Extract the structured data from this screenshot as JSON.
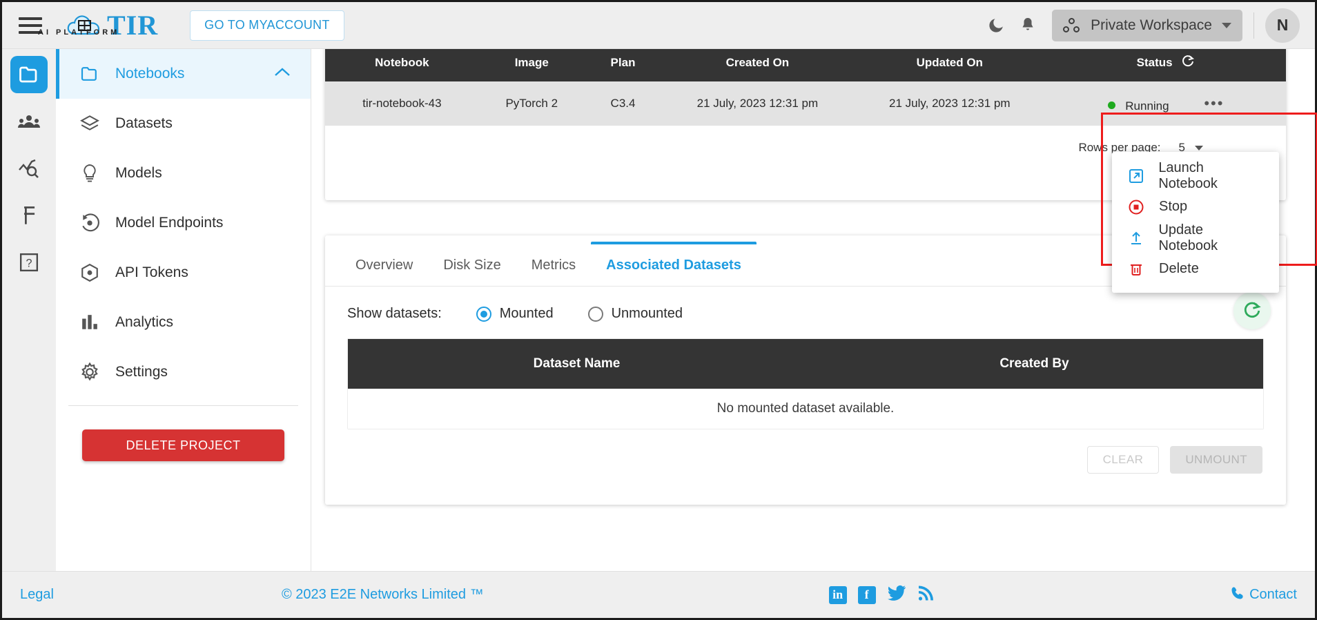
{
  "topbar": {
    "menu_icon": "hamburger-icon",
    "logo_text": "TIR",
    "logo_sub": "AI PLATFORM",
    "myaccount_label": "GO TO MYACCOUNT",
    "dark_mode_icon": "moon-icon",
    "notifications_icon": "bell-icon",
    "workspace_label": "Private Workspace",
    "avatar_initial": "N"
  },
  "rail": {
    "items": [
      {
        "icon": "folder-icon",
        "name": "projects",
        "active": true
      },
      {
        "icon": "users-icon",
        "name": "team",
        "active": false
      },
      {
        "icon": "analytics-search-icon",
        "name": "monitoring",
        "active": false
      },
      {
        "icon": "rupee-icon",
        "name": "billing",
        "active": false
      },
      {
        "icon": "help-icon",
        "name": "help",
        "active": false
      }
    ]
  },
  "sidenav": {
    "items": [
      {
        "label": "Notebooks",
        "icon": "folder-outline-icon",
        "active": true,
        "expandable": true
      },
      {
        "label": "Datasets",
        "icon": "layers-icon",
        "active": false
      },
      {
        "label": "Models",
        "icon": "bulb-icon",
        "active": false
      },
      {
        "label": "Model Endpoints",
        "icon": "endpoint-icon",
        "active": false
      },
      {
        "label": "API Tokens",
        "icon": "cube-icon",
        "active": false
      },
      {
        "label": "Analytics",
        "icon": "bar-chart-icon",
        "active": false
      },
      {
        "label": "Settings",
        "icon": "gear-icon",
        "active": false
      }
    ],
    "delete_project_label": "DELETE PROJECT"
  },
  "notebooks_table": {
    "columns": [
      "Notebook",
      "Image",
      "Plan",
      "Created On",
      "Updated On",
      "Status"
    ],
    "status_refresh_icon": "refresh-icon",
    "rows": [
      {
        "notebook": "tir-notebook-43",
        "image": "PyTorch 2",
        "plan": "C3.4",
        "created_on": "21 July, 2023 12:31 pm",
        "updated_on": "21 July, 2023 12:31 pm",
        "status": "Running",
        "status_color": "#1faa1f",
        "actions_icon": "kebab-menu-icon"
      }
    ],
    "rows_per_page_label": "Rows per page:",
    "rows_per_page_value": "5"
  },
  "actions_menu": {
    "items": [
      {
        "label": "Launch Notebook",
        "icon": "external-link-icon",
        "color": "#1e9ce0"
      },
      {
        "label": "Stop",
        "icon": "stop-circle-icon",
        "color": "#e02020"
      },
      {
        "label": "Update Notebook",
        "icon": "upload-icon",
        "color": "#1e9ce0"
      },
      {
        "label": "Delete",
        "icon": "trash-icon",
        "color": "#e02020"
      }
    ]
  },
  "detail": {
    "tabs": [
      {
        "label": "Overview",
        "active": false
      },
      {
        "label": "Disk Size",
        "active": false
      },
      {
        "label": "Metrics",
        "active": false
      },
      {
        "label": "Associated Datasets",
        "active": true
      }
    ],
    "show_datasets_label": "Show datasets:",
    "radio_options": [
      {
        "label": "Mounted",
        "selected": true
      },
      {
        "label": "Unmounted",
        "selected": false
      }
    ],
    "refresh_icon": "refresh-circle-icon",
    "datasets_columns": [
      "Dataset Name",
      "Created By"
    ],
    "empty_message": "No mounted dataset available.",
    "clear_label": "CLEAR",
    "unmount_label": "UNMOUNT"
  },
  "footer": {
    "legal": "Legal",
    "copyright": "© 2023 E2E Networks Limited ™",
    "social": [
      "linkedin-icon",
      "facebook-icon",
      "twitter-icon",
      "rss-icon"
    ],
    "contact": "Contact",
    "contact_icon": "phone-icon"
  },
  "colors": {
    "accent": "#1e9ce0",
    "danger": "#d63333",
    "highlight": "#ee1c1c",
    "header_dark": "#343434",
    "row_gray": "#e3e3e3"
  }
}
